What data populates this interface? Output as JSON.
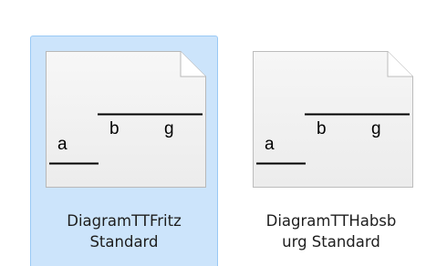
{
  "files": [
    {
      "name_line1": "DiagramTTFritz",
      "name_line2": "Standard",
      "selected": true,
      "thumbnail": {
        "icon": "document-page-icon",
        "letters": [
          "a",
          "b",
          "g"
        ]
      }
    },
    {
      "name_line1": "DiagramTTHabsb",
      "name_line2": "urg Standard",
      "selected": false,
      "thumbnail": {
        "icon": "document-page-icon",
        "letters": [
          "a",
          "b",
          "g"
        ]
      }
    }
  ],
  "colors": {
    "selection_fill": "#cce4fb",
    "selection_border": "#99c9f5",
    "page_fill": "#f4f4f4",
    "page_border": "#b8b8b8",
    "text": "#1e1e1e"
  }
}
